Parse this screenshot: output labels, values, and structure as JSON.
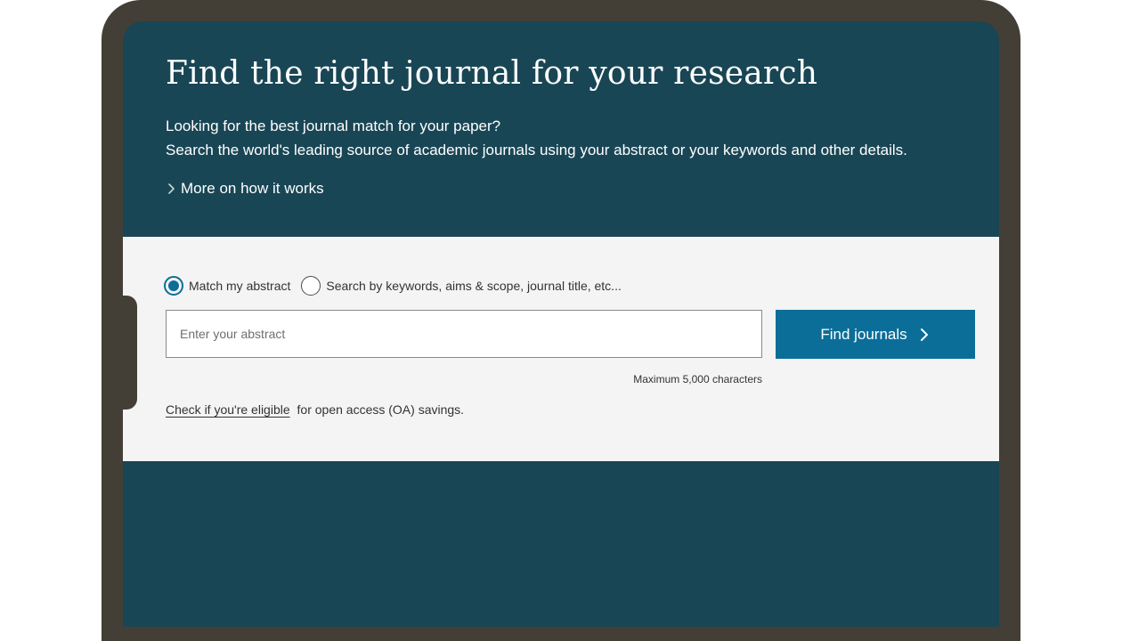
{
  "hero": {
    "title": "Find the right journal for your research",
    "desc_line1": "Looking for the best journal match for your paper?",
    "desc_line2": "Search the world's leading source of academic journals using your abstract or your keywords and other details.",
    "more_link": "More on how it works"
  },
  "search": {
    "options": [
      {
        "label": "Match my abstract",
        "selected": true
      },
      {
        "label": "Search by keywords, aims & scope, journal title, etc...",
        "selected": false
      }
    ],
    "placeholder": "Enter your abstract",
    "value": "",
    "button_label": "Find journals",
    "max_chars": "Maximum 5,000 characters",
    "eligible_link": "Check if you're eligible",
    "eligible_text": "for open access (OA) savings."
  },
  "colors": {
    "frame": "#433f37",
    "hero_bg": "#194655",
    "panel_bg": "#f4f4f4",
    "accent": "#0b6e99"
  },
  "icons": [
    "chevron-right-icon"
  ]
}
